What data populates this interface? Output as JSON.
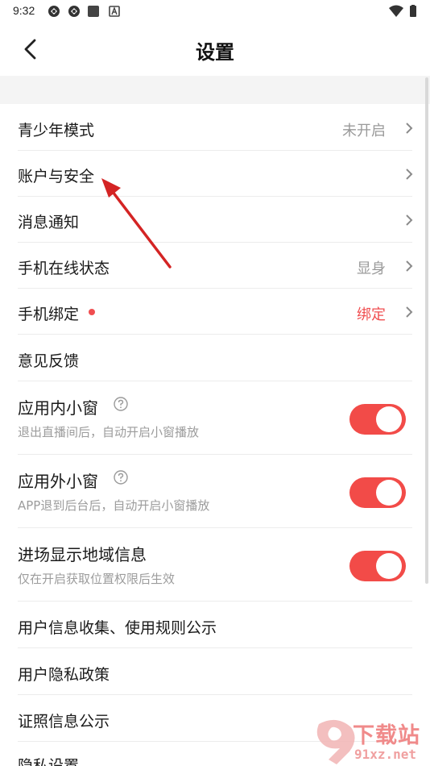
{
  "status_bar": {
    "time": "9:32"
  },
  "header": {
    "title": "设置"
  },
  "rows": {
    "teen_mode": {
      "label": "青少年模式",
      "value": "未开启"
    },
    "account_security": {
      "label": "账户与安全"
    },
    "notifications": {
      "label": "消息通知"
    },
    "online_status": {
      "label": "手机在线状态",
      "value": "显身"
    },
    "phone_binding": {
      "label": "手机绑定",
      "value": "绑定"
    },
    "feedback": {
      "label": "意见反馈"
    },
    "in_app_window": {
      "label": "应用内小窗",
      "desc": "退出直播间后，自动开启小窗播放",
      "enabled": true
    },
    "out_app_window": {
      "label": "应用外小窗",
      "desc": "APP退到后台后，自动开启小窗播放",
      "enabled": true
    },
    "region_info": {
      "label": "进场显示地域信息",
      "desc": "仅在开启获取位置权限后生效",
      "enabled": true
    },
    "info_rules": {
      "label": "用户信息收集、使用规则公示"
    },
    "privacy_policy": {
      "label": "用户隐私政策"
    },
    "license_info": {
      "label": "证照信息公示"
    },
    "privacy_settings": {
      "label": "隐私设置"
    }
  },
  "watermark": {
    "brand": "下载站",
    "domain": "91xz.net"
  },
  "colors": {
    "accent": "#f24b48",
    "gray_text": "#9a9a9a",
    "arrow": "#d42424"
  }
}
